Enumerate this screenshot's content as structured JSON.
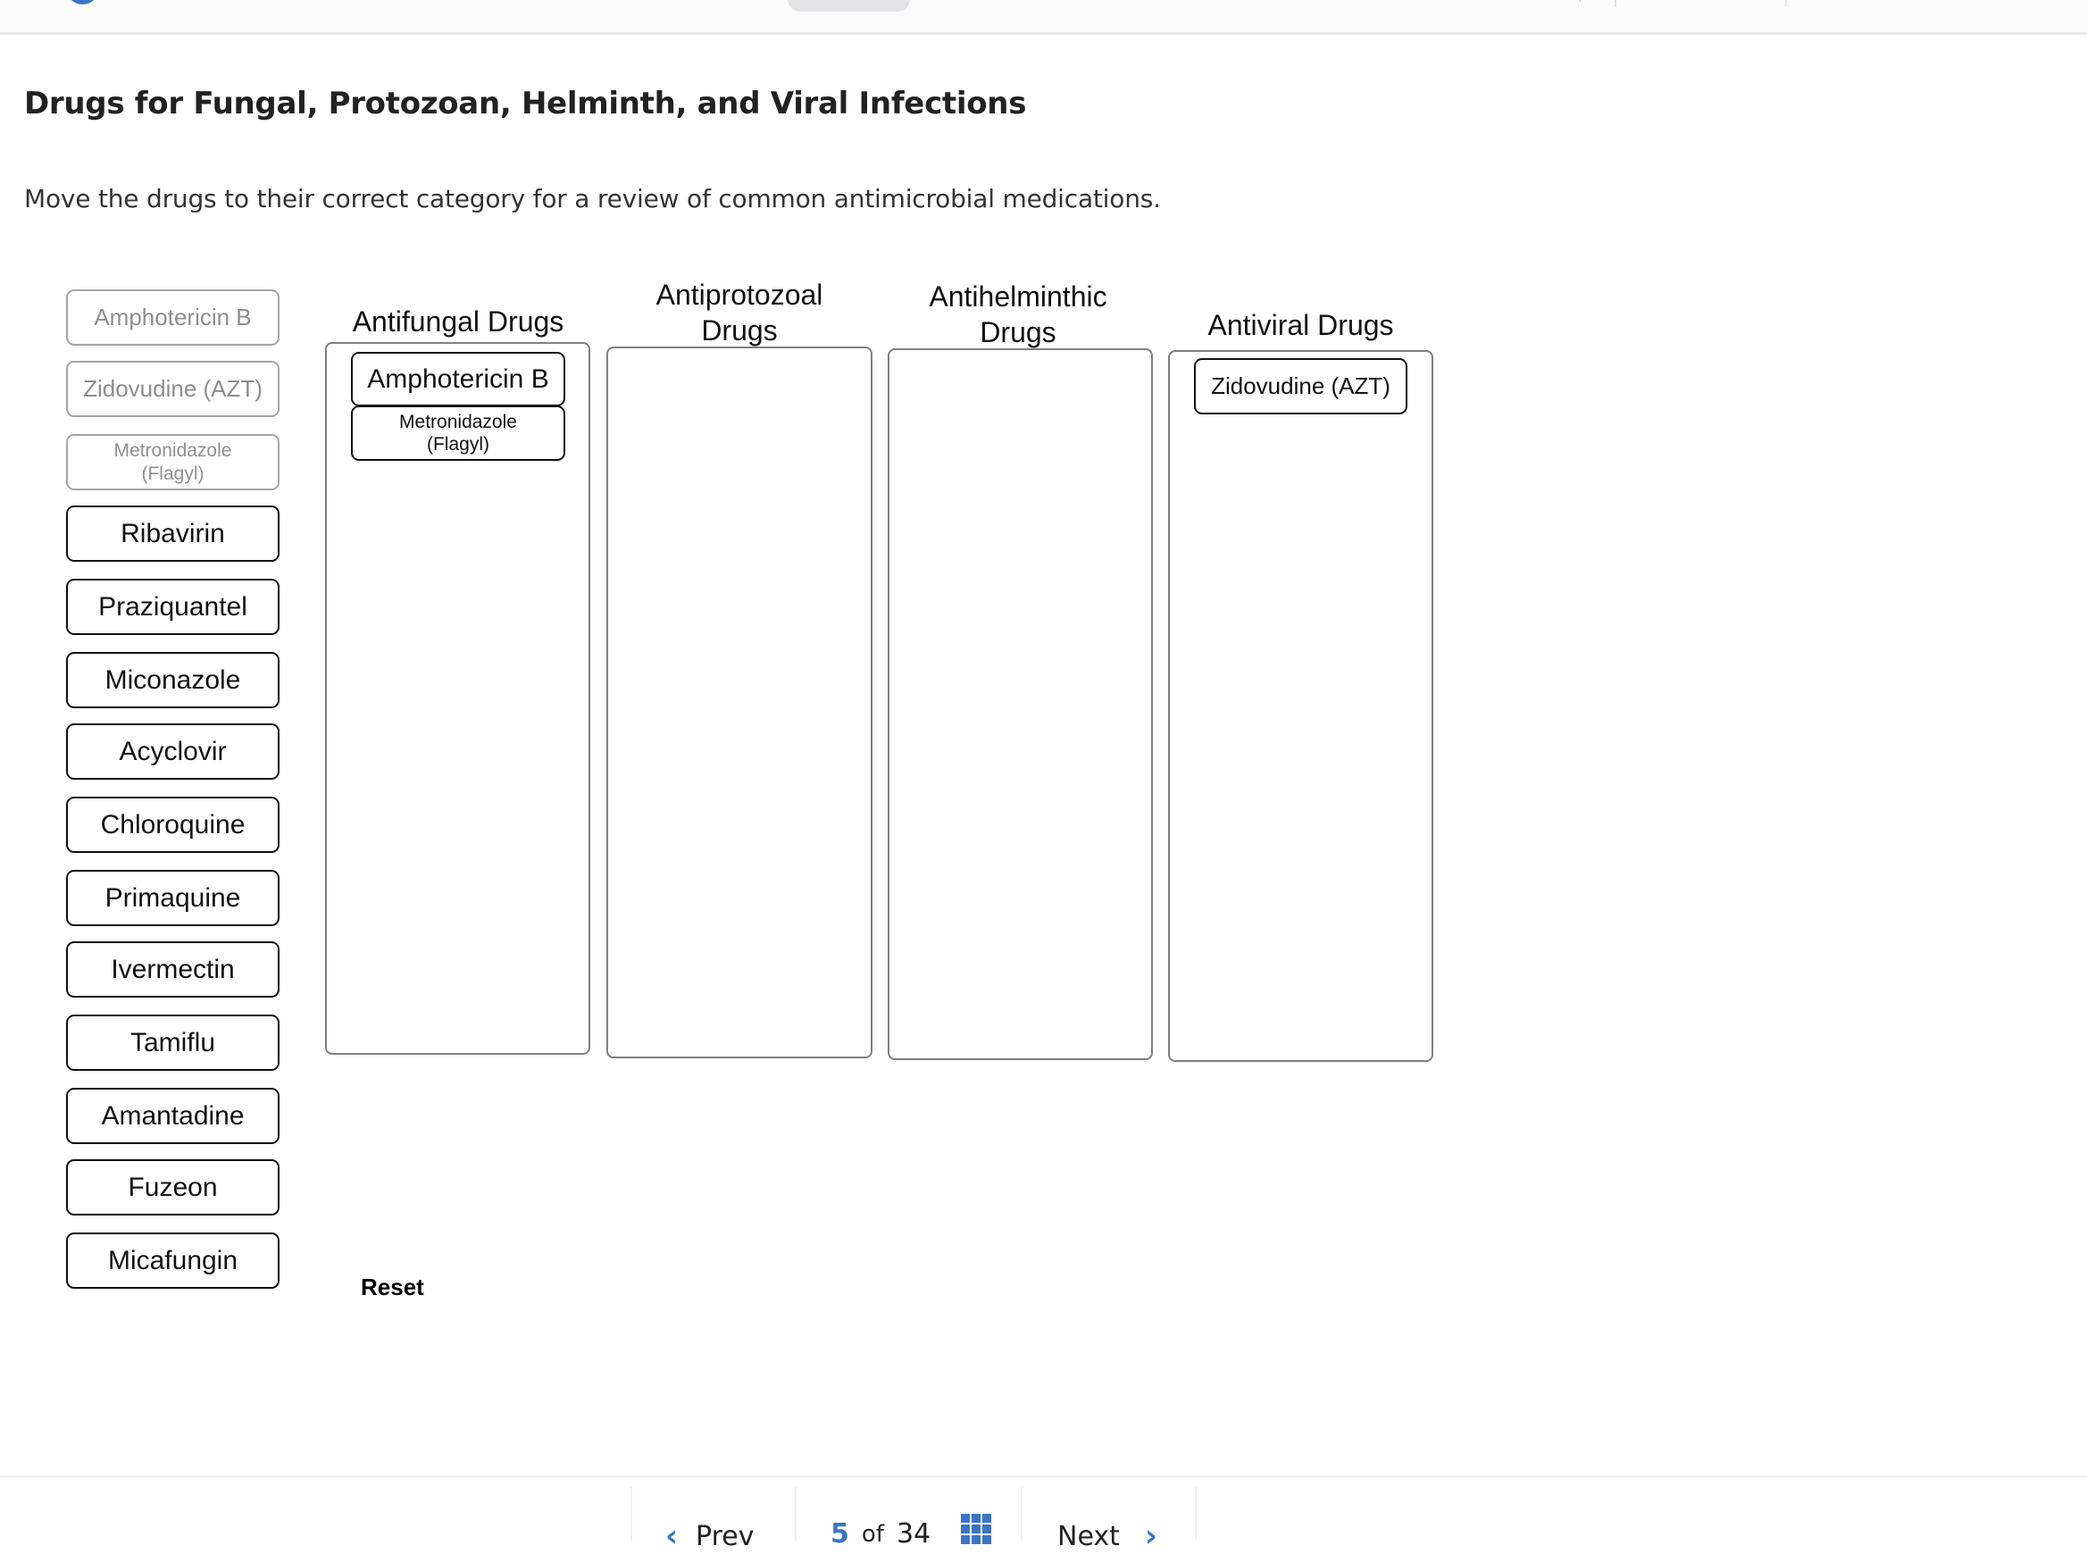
{
  "header": {
    "logo_icon": "brand-circle-icon"
  },
  "page": {
    "title": "Drugs for Fungal, Protozoan, Helminth, and Viral Infections",
    "instructions": "Move the drugs to their correct category for a review of common antimicrobial medications."
  },
  "source_items": [
    {
      "label": "Amphotericin B",
      "placed": true
    },
    {
      "label": "Zidovudine (AZT)",
      "placed": true
    },
    {
      "label": "Metronidazole (Flagyl)",
      "placed": true
    },
    {
      "label": "Ribavirin",
      "placed": false
    },
    {
      "label": "Praziquantel",
      "placed": false
    },
    {
      "label": "Miconazole",
      "placed": false
    },
    {
      "label": "Acyclovir",
      "placed": false
    },
    {
      "label": "Chloroquine",
      "placed": false
    },
    {
      "label": "Primaquine",
      "placed": false
    },
    {
      "label": "Ivermectin",
      "placed": false
    },
    {
      "label": "Tamiflu",
      "placed": false
    },
    {
      "label": "Amantadine",
      "placed": false
    },
    {
      "label": "Fuzeon",
      "placed": false
    },
    {
      "label": "Micafungin",
      "placed": false
    }
  ],
  "categories": [
    {
      "label": "Antifungal Drugs",
      "items": [
        "Amphotericin B",
        "Metronidazole (Flagyl)"
      ]
    },
    {
      "label": "Antiprotozoal Drugs",
      "items": []
    },
    {
      "label": "Antihelminthic Drugs",
      "items": []
    },
    {
      "label": "Antiviral Drugs",
      "items": [
        "Zidovudine (AZT)"
      ]
    }
  ],
  "actions": {
    "reset_label": "Reset"
  },
  "navigation": {
    "prev_label": "Prev",
    "next_label": "Next",
    "current_page": "5",
    "of_label": "of",
    "total_pages": "34"
  },
  "colors": {
    "accent": "#3a75c4",
    "chip_border": "#111111",
    "chip_used_text": "#8e8e8e",
    "bin_border": "#7f7f7f"
  }
}
